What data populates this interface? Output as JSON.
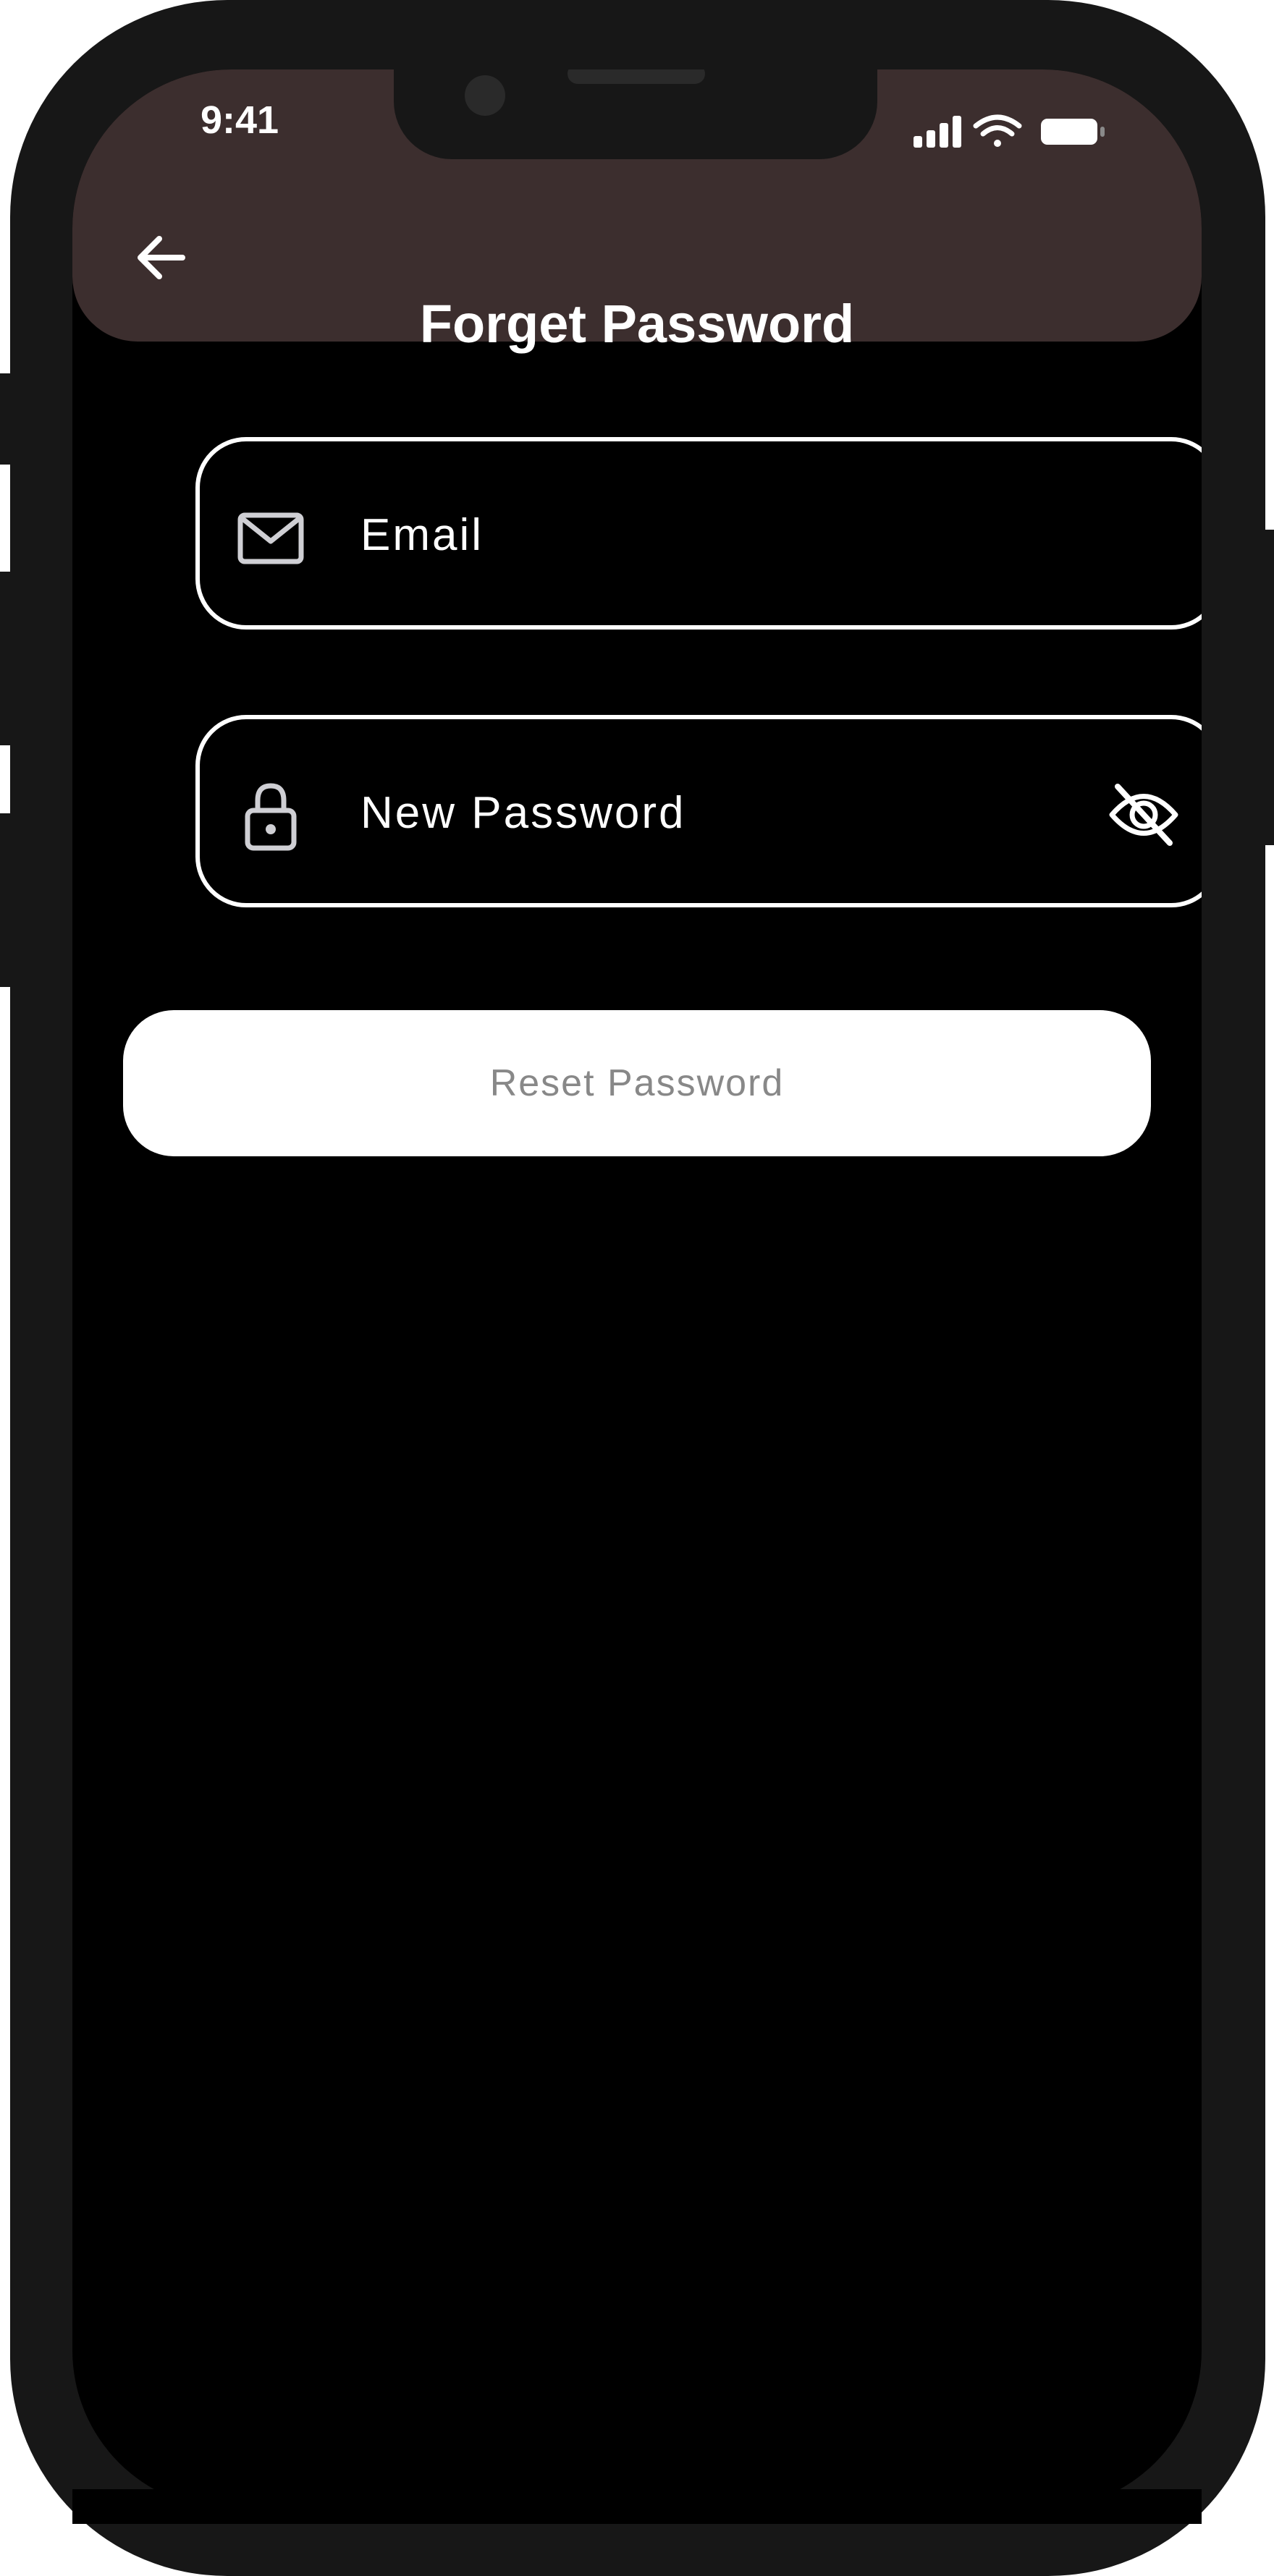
{
  "status_bar": {
    "time": "9:41"
  },
  "header": {
    "title": "Forget Password",
    "back_icon": "arrow-left-icon",
    "background": "#3c2e2e"
  },
  "form": {
    "email": {
      "placeholder": "Email",
      "icon": "mail-icon"
    },
    "new_password": {
      "placeholder": "New Password",
      "icon": "lock-icon",
      "toggle_icon": "eye-off-icon"
    },
    "reset_button": {
      "label": "Reset Password"
    }
  },
  "colors": {
    "frame": "#171717",
    "screen": "#000000",
    "field_border": "#ffffff",
    "button_bg": "#ffffff",
    "button_text": "#888888"
  }
}
